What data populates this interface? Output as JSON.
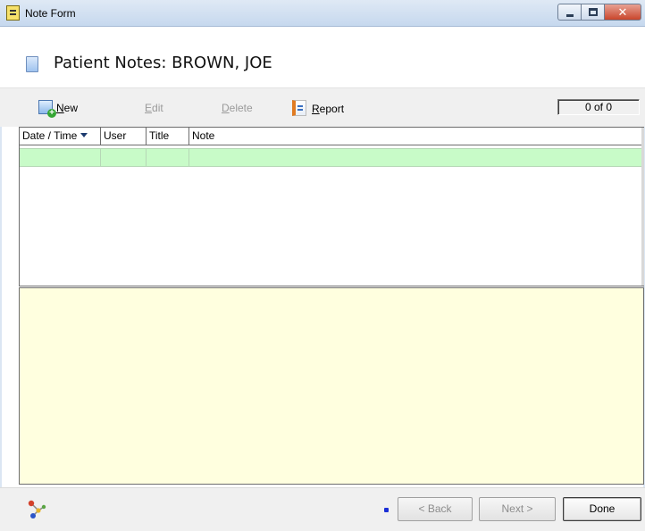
{
  "window": {
    "title": "Note Form",
    "controls": [
      "minimize",
      "maximize",
      "close"
    ],
    "close_glyph": "✕"
  },
  "header": {
    "title": "Patient Notes:  BROWN, JOE",
    "icon": "document-icon"
  },
  "toolbar": {
    "new": {
      "prefix": "",
      "mnemonic": "N",
      "rest": "ew",
      "enabled": true
    },
    "edit": {
      "mnemonic": "E",
      "rest": "dit",
      "enabled": false
    },
    "delete": {
      "mnemonic": "D",
      "rest": "elete",
      "enabled": false
    },
    "report": {
      "mnemonic": "R",
      "rest": "eport",
      "enabled": true
    },
    "record_counter": "0 of 0"
  },
  "grid": {
    "columns": [
      "Date / Time",
      "User",
      "Title",
      "Note"
    ],
    "sorted_column": "Date / Time",
    "rows": [
      {
        "date_time": "",
        "user": "",
        "title": "",
        "note": "",
        "selected": true
      }
    ]
  },
  "note_text": "",
  "bottom": {
    "back_label": "< Back",
    "next_label": "Next >",
    "done_label": "Done",
    "back_enabled": false,
    "next_enabled": false
  },
  "colors": {
    "selected_row": "#c8fbc8",
    "note_background": "#ffffdf",
    "titlebar": "#c6d8ee"
  }
}
